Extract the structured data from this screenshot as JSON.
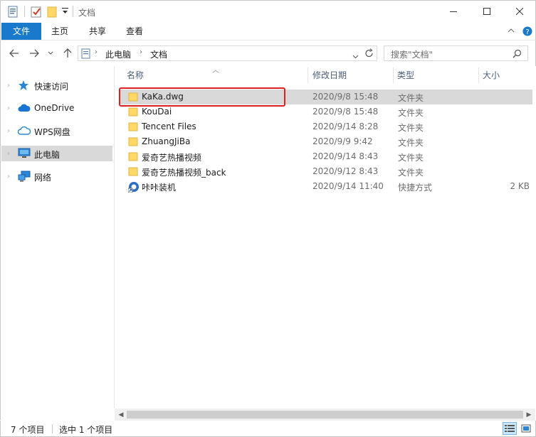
{
  "window": {
    "title": "文档",
    "controls": [
      "minimize-icon",
      "maximize-icon",
      "close-icon"
    ]
  },
  "ribbon": {
    "tabs": [
      {
        "label": "文件",
        "active": true
      },
      {
        "label": "主页"
      },
      {
        "label": "共享"
      },
      {
        "label": "查看"
      }
    ]
  },
  "address": {
    "crumbs": [
      "此电脑",
      "文档"
    ],
    "search_placeholder": "搜索\"文档\""
  },
  "nav": {
    "items": [
      {
        "label": "快速访问",
        "icon": "star-icon"
      },
      {
        "label": "OneDrive",
        "icon": "cloud-icon"
      },
      {
        "label": "WPS网盘",
        "icon": "cloud-outline-icon"
      },
      {
        "label": "此电脑",
        "icon": "computer-icon",
        "selected": true
      },
      {
        "label": "网络",
        "icon": "network-icon"
      }
    ]
  },
  "columns": {
    "name": "名称",
    "date": "修改日期",
    "type": "类型",
    "size": "大小"
  },
  "files": [
    {
      "name": "KaKa.dwg",
      "date": "2020/9/8 15:48",
      "type": "文件夹",
      "size": "",
      "icon": "folder-icon",
      "selected": true
    },
    {
      "name": "KouDai",
      "date": "2020/9/8 15:48",
      "type": "文件夹",
      "size": "",
      "icon": "folder-icon"
    },
    {
      "name": "Tencent Files",
      "date": "2020/9/14 8:28",
      "type": "文件夹",
      "size": "",
      "icon": "folder-icon"
    },
    {
      "name": "ZhuangJiBa",
      "date": "2020/9/9 9:42",
      "type": "文件夹",
      "size": "",
      "icon": "folder-icon"
    },
    {
      "name": "爱奇艺热播视频",
      "date": "2020/9/14 8:43",
      "type": "文件夹",
      "size": "",
      "icon": "folder-icon"
    },
    {
      "name": "爱奇艺热播视频_back",
      "date": "2020/9/12 8:43",
      "type": "文件夹",
      "size": "",
      "icon": "folder-icon"
    },
    {
      "name": "咔咔装机",
      "date": "2020/9/14 11:40",
      "type": "快捷方式",
      "size": "2 KB",
      "icon": "shortcut-app-icon"
    }
  ],
  "status": {
    "count": "7 个项目",
    "selected": "选中 1 个项目"
  },
  "colors": {
    "accent": "#1979ca",
    "selection": "#d9d9d9",
    "highlight_box": "#e02020",
    "folder": "#ffd867"
  }
}
